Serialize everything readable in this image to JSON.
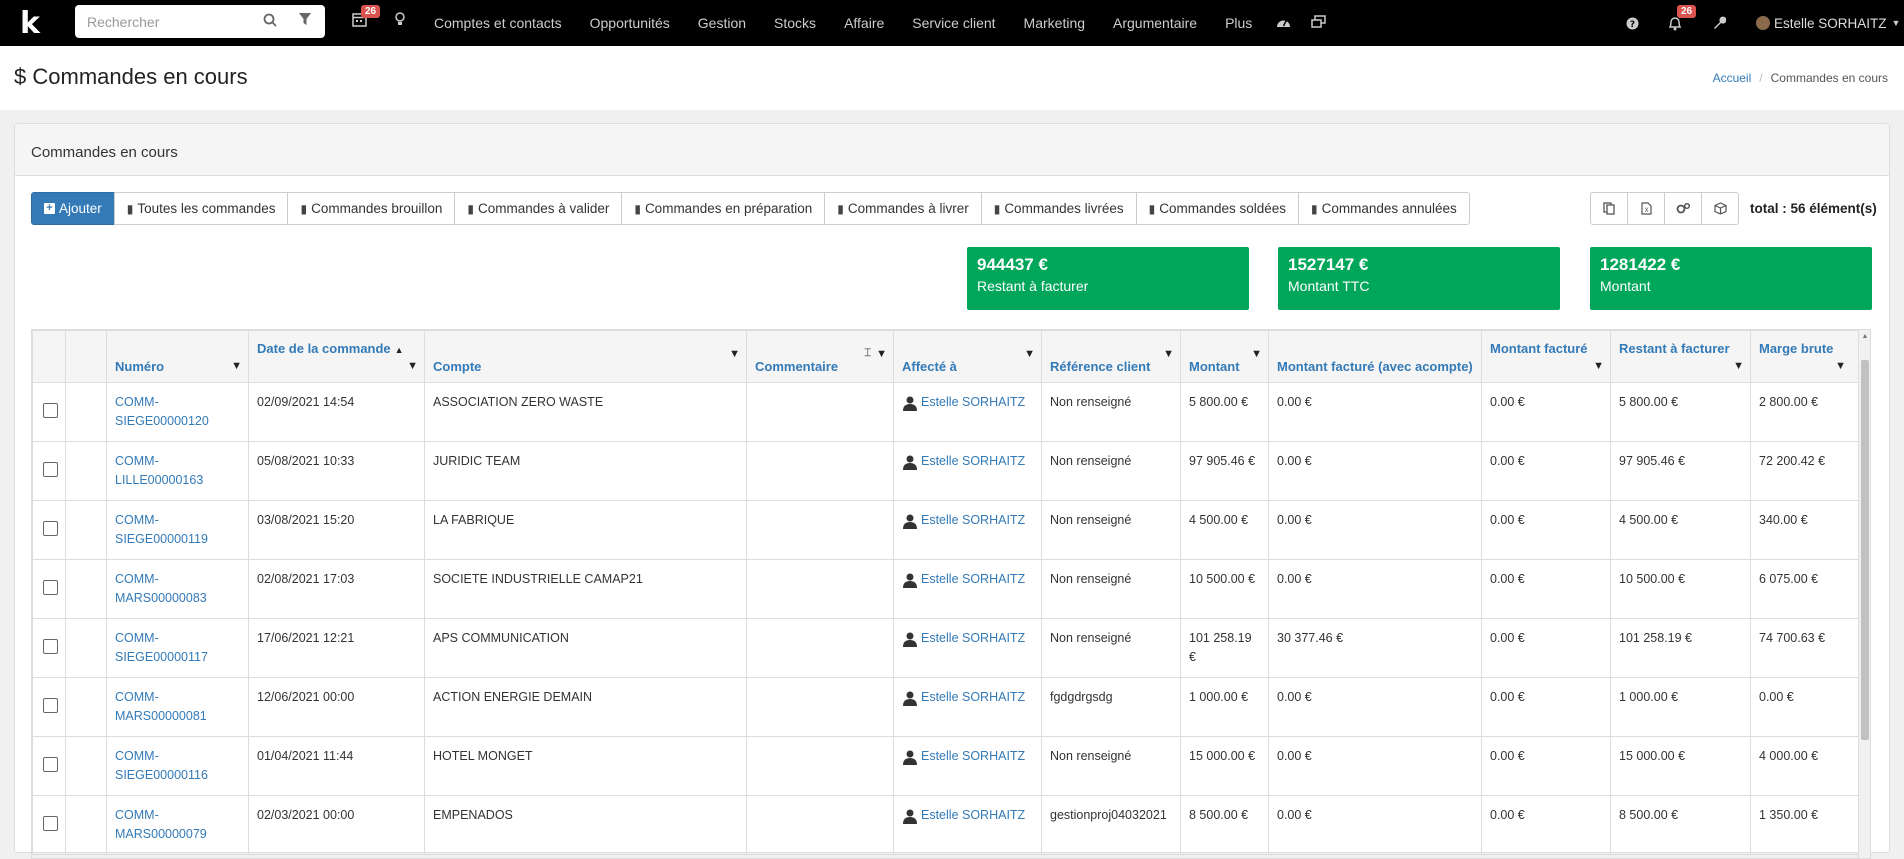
{
  "topbar": {
    "logo": "k",
    "search_placeholder": "Rechercher",
    "calendar_badge": "26",
    "menu": [
      "Comptes et contacts",
      "Opportunités",
      "Gestion",
      "Stocks",
      "Affaire",
      "Service client",
      "Marketing",
      "Argumentaire",
      "Plus"
    ],
    "notif_badge": "26",
    "user": "Estelle SORHAITZ"
  },
  "header": {
    "title_icon": "$",
    "title": "Commandes en cours",
    "breadcrumb_home": "Accueil",
    "breadcrumb_current": "Commandes en cours"
  },
  "panel": {
    "title": "Commandes en cours",
    "add_button": "Ajouter",
    "filters": [
      "Toutes les commandes",
      "Commandes brouillon",
      "Commandes à valider",
      "Commandes en préparation",
      "Commandes à livrer",
      "Commandes livrées",
      "Commandes soldées",
      "Commandes annulées"
    ],
    "total": "total : 56 élément(s)"
  },
  "stats": [
    {
      "value": "944437 €",
      "label": "Restant à facturer"
    },
    {
      "value": "1527147 €",
      "label": "Montant TTC"
    },
    {
      "value": "1281422 €",
      "label": "Montant"
    }
  ],
  "table": {
    "columns": [
      "Numéro",
      "Date de la commande",
      "Compte",
      "Commentaire",
      "Affecté à",
      "Référence client",
      "Montant",
      "Montant facturé (avec acompte)",
      "Montant facturé",
      "Restant à facturer",
      "Marge brute"
    ],
    "rows": [
      {
        "num": "COMM-SIEGE00000120",
        "date": "02/09/2021 14:54",
        "compte": "ASSOCIATION ZERO WASTE",
        "comment": "",
        "affecte": "Estelle SORHAITZ",
        "ref": "Non renseigné",
        "montant": "5 800.00 €",
        "facture_acompte": "0.00 €",
        "facture": "0.00 €",
        "restant": "5 800.00 €",
        "marge": "2 800.00 €"
      },
      {
        "num": "COMM-LILLE00000163",
        "date": "05/08/2021 10:33",
        "compte": "JURIDIC TEAM",
        "comment": "",
        "affecte": "Estelle SORHAITZ",
        "ref": "Non renseigné",
        "montant": "97 905.46 €",
        "facture_acompte": "0.00 €",
        "facture": "0.00 €",
        "restant": "97 905.46 €",
        "marge": "72 200.42 €"
      },
      {
        "num": "COMM-SIEGE00000119",
        "date": "03/08/2021 15:20",
        "compte": "LA FABRIQUE",
        "comment": "",
        "affecte": "Estelle SORHAITZ",
        "ref": "Non renseigné",
        "montant": "4 500.00 €",
        "facture_acompte": "0.00 €",
        "facture": "0.00 €",
        "restant": "4 500.00 €",
        "marge": "340.00 €"
      },
      {
        "num": "COMM-MARS00000083",
        "date": "02/08/2021 17:03",
        "compte": "SOCIETE INDUSTRIELLE CAMAP21",
        "comment": "",
        "affecte": "Estelle SORHAITZ",
        "ref": "Non renseigné",
        "montant": "10 500.00 €",
        "facture_acompte": "0.00 €",
        "facture": "0.00 €",
        "restant": "10 500.00 €",
        "marge": "6 075.00 €"
      },
      {
        "num": "COMM-SIEGE00000117",
        "date": "17/06/2021 12:21",
        "compte": "APS COMMUNICATION",
        "comment": "",
        "affecte": "Estelle SORHAITZ",
        "ref": "Non renseigné",
        "montant": "101 258.19 €",
        "facture_acompte": "30 377.46 €",
        "facture": "0.00 €",
        "restant": "101 258.19 €",
        "marge": "74 700.63 €"
      },
      {
        "num": "COMM-MARS00000081",
        "date": "12/06/2021 00:00",
        "compte": "ACTION ENERGIE DEMAIN",
        "comment": "",
        "affecte": "Estelle SORHAITZ",
        "ref": "fgdgdrgsdg",
        "montant": "1 000.00 €",
        "facture_acompte": "0.00 €",
        "facture": "0.00 €",
        "restant": "1 000.00 €",
        "marge": "0.00 €"
      },
      {
        "num": "COMM-SIEGE00000116",
        "date": "01/04/2021 11:44",
        "compte": "HOTEL MONGET",
        "comment": "",
        "affecte": "Estelle SORHAITZ",
        "ref": "Non renseigné",
        "montant": "15 000.00 €",
        "facture_acompte": "0.00 €",
        "facture": "0.00 €",
        "restant": "15 000.00 €",
        "marge": "4 000.00 €"
      },
      {
        "num": "COMM-MARS00000079",
        "date": "02/03/2021 00:00",
        "compte": "EMPENADOS",
        "comment": "",
        "affecte": "Estelle SORHAITZ",
        "ref": "gestionproj04032021",
        "montant": "8 500.00 €",
        "facture_acompte": "0.00 €",
        "facture": "0.00 €",
        "restant": "8 500.00 €",
        "marge": "1 350.00 €"
      }
    ]
  },
  "colors": {
    "topbar": "#000000",
    "primary": "#337ab7",
    "stat": "#00a65a",
    "badge": "#d9534f"
  }
}
